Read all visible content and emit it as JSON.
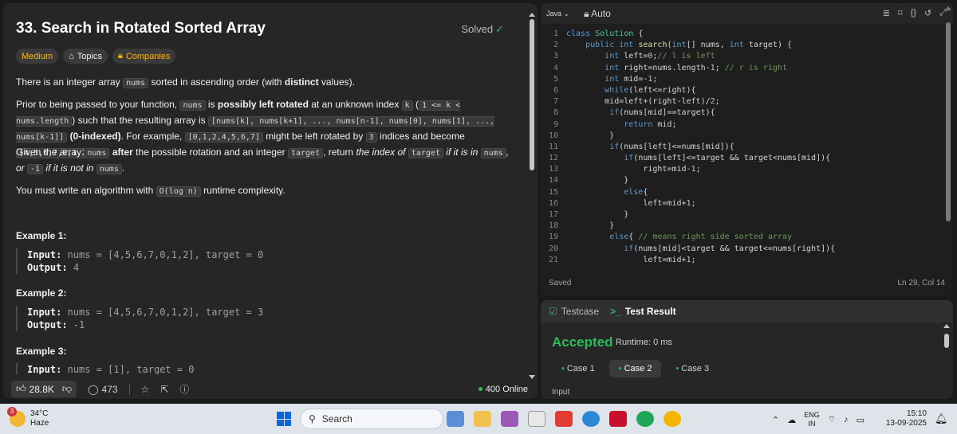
{
  "problem": {
    "title": "33. Search in Rotated Sorted Array",
    "status": "Solved",
    "tags": {
      "difficulty": "Medium",
      "topics": "Topics",
      "companies": "Companies"
    },
    "p1": {
      "a": "There is an integer array ",
      "code1": "nums",
      "b": " sorted in ascending order (with ",
      "bold": "distinct",
      "c": " values)."
    },
    "p2": {
      "a": "Prior to being passed to your function, ",
      "c1": "nums",
      "b": " is ",
      "bold1": "possibly left rotated",
      "c": " at an unknown index ",
      "c2": "k",
      "d": " (",
      "c3": "1 <= k < nums.length",
      "e": ") such that the resulting array is ",
      "c4": "[nums[k], nums[k+1], ..., nums[n-1], nums[0], nums[1], ..., nums[k-1]]",
      "f": " ",
      "bold2": "(0-indexed)",
      "g": ". For example, ",
      "c5": "[0,1,2,4,5,6,7]",
      "h": " might be left rotated by ",
      "c6": "3",
      "i": " indices and become ",
      "c7": "[4,5,6,7,0,1,2]",
      "j": "."
    },
    "p3": {
      "a": "Given the array ",
      "c1": "nums",
      "b": " ",
      "bold": "after",
      "c": " the possible rotation and an integer ",
      "c2": "target",
      "d": ", return ",
      "it1": "the index of ",
      "c3": "target",
      "it2": " if it is in ",
      "c4": "nums",
      "it3": ", or ",
      "c5": "-1",
      "it4": " if it is not in ",
      "c6": "nums",
      "e": "."
    },
    "p4": {
      "a": "You must write an algorithm with ",
      "c1": "O(log n)",
      "b": " runtime complexity."
    },
    "examples": [
      {
        "title": "Example 1:",
        "input_label": "Input:",
        "input": "nums = [4,5,6,7,0,1,2], target = 0",
        "output_label": "Output:",
        "output": "4"
      },
      {
        "title": "Example 2:",
        "input_label": "Input:",
        "input": "nums = [4,5,6,7,0,1,2], target = 3",
        "output_label": "Output:",
        "output": "-1"
      },
      {
        "title": "Example 3:",
        "input_label": "Input:",
        "input": "nums = [1], target = 0"
      }
    ],
    "footer": {
      "likes": "28.8K",
      "comments": "473",
      "online": "400 Online"
    }
  },
  "editor": {
    "language": "Java",
    "mode": "Auto",
    "status": "Saved",
    "cursor": "Ln 29, Col 14",
    "lines": [
      {
        "n": "1",
        "t": "class Solution {"
      },
      {
        "n": "2",
        "t": "    public int search(int[] nums, int target) {"
      },
      {
        "n": "3",
        "t": "        int left=0;// l is left"
      },
      {
        "n": "4",
        "t": "        int right=nums.length-1; // r is right"
      },
      {
        "n": "5",
        "t": "        int mid=-1;"
      },
      {
        "n": "6",
        "t": "        while(left<=right){"
      },
      {
        "n": "7",
        "t": "        mid=left+(right-left)/2;"
      },
      {
        "n": "8",
        "t": "         if(nums[mid]==target){"
      },
      {
        "n": "9",
        "t": "            return mid;"
      },
      {
        "n": "10",
        "t": "         }"
      },
      {
        "n": "11",
        "t": "         if(nums[left]<=nums[mid]){"
      },
      {
        "n": "12",
        "t": "            if(nums[left]<=target && target<nums[mid]){"
      },
      {
        "n": "13",
        "t": "                right=mid-1;"
      },
      {
        "n": "14",
        "t": "            }"
      },
      {
        "n": "15",
        "t": "            else{"
      },
      {
        "n": "16",
        "t": "                left=mid+1;"
      },
      {
        "n": "17",
        "t": "            }"
      },
      {
        "n": "18",
        "t": "         }"
      },
      {
        "n": "19",
        "t": "         else{ // means right side sorted array"
      },
      {
        "n": "20",
        "t": "            if(nums[mid]<target && target<=nums[right]){"
      },
      {
        "n": "21",
        "t": "                left=mid+1;"
      }
    ]
  },
  "test": {
    "tab_testcase": "Testcase",
    "tab_result": "Test Result",
    "verdict": "Accepted",
    "runtime": "Runtime: 0 ms",
    "cases": [
      "Case 1",
      "Case 2",
      "Case 3"
    ],
    "input_label": "Input"
  },
  "taskbar": {
    "temp": "34°C",
    "weather": "Haze",
    "badge": "3",
    "search": "Search",
    "lang1": "ENG",
    "lang2": "IN",
    "time": "15:10",
    "date": "13-09-2025"
  }
}
